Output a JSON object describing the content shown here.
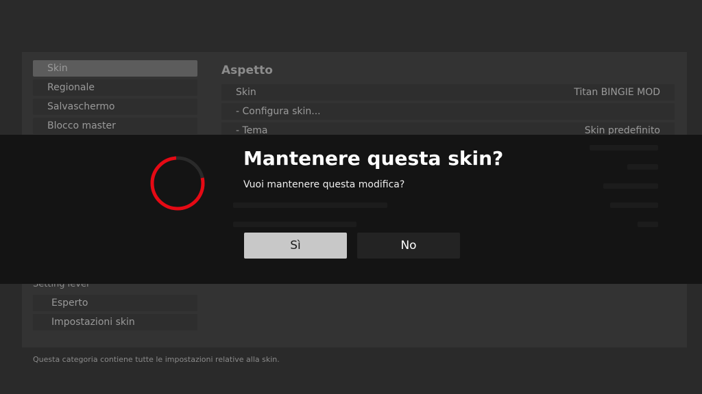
{
  "sidebar": {
    "items": [
      {
        "label": "Skin",
        "active": true
      },
      {
        "label": "Regionale",
        "active": false
      },
      {
        "label": "Salvaschermo",
        "active": false
      },
      {
        "label": "Blocco master",
        "active": false
      }
    ],
    "group_label": "Setting level",
    "sub_items": [
      {
        "label": "Esperto"
      },
      {
        "label": "Impostazioni skin"
      }
    ]
  },
  "main": {
    "section_title": "Aspetto",
    "rows": [
      {
        "label": "Skin",
        "value": "Titan BINGIE MOD"
      },
      {
        "label": "- Configura skin...",
        "value": ""
      },
      {
        "label": "- Tema",
        "value": "Skin predefinito"
      }
    ]
  },
  "footer": {
    "hint": "Questa categoria contiene tutte le impostazioni relative alla skin."
  },
  "dialog": {
    "title": "Mantenere questa skin?",
    "message": "Vuoi mantenere questa modifica?",
    "yes_label": "Sì",
    "no_label": "No",
    "accent_color": "#e50914"
  }
}
